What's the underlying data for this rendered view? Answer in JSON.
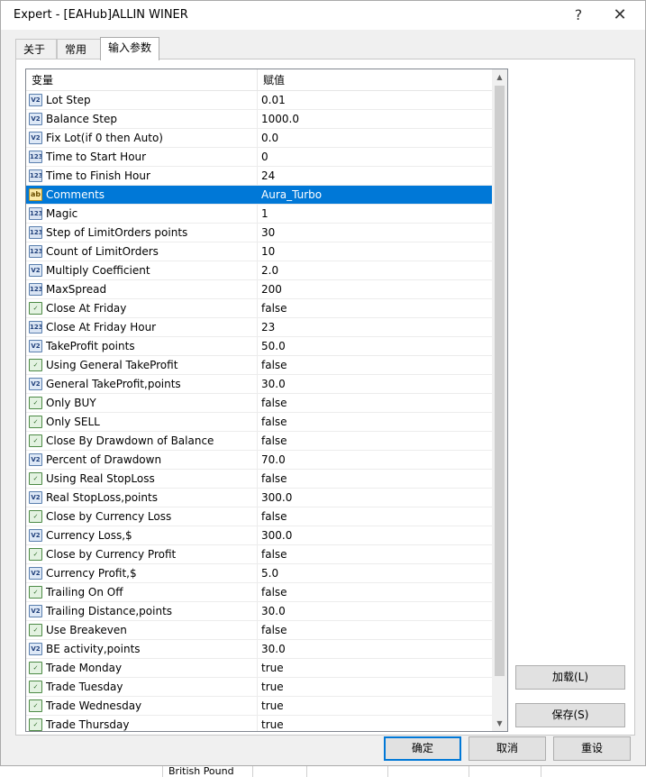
{
  "window": {
    "title": "Expert - [EAHub]ALLIN WINER",
    "help": "?",
    "close": "✕"
  },
  "tabs": [
    {
      "label": "关于"
    },
    {
      "label": "常用"
    },
    {
      "label": "输入参数"
    }
  ],
  "grid": {
    "col_variable": "变量",
    "col_value": "赋值",
    "rows": [
      {
        "type": "double",
        "icon": "V2",
        "name": "Lot Step",
        "value": "0.01"
      },
      {
        "type": "double",
        "icon": "V2",
        "name": "Balance Step",
        "value": "1000.0"
      },
      {
        "type": "double",
        "icon": "V2",
        "name": "Fix Lot(if 0 then Auto)",
        "value": "0.0"
      },
      {
        "type": "int",
        "icon": "123",
        "name": "Time to Start Hour",
        "value": "0"
      },
      {
        "type": "int",
        "icon": "123",
        "name": "Time to Finish Hour",
        "value": "24"
      },
      {
        "type": "string",
        "icon": "ab",
        "name": "Comments",
        "value": "Aura_Turbo"
      },
      {
        "type": "int",
        "icon": "123",
        "name": "Magic",
        "value": "1"
      },
      {
        "type": "int",
        "icon": "123",
        "name": "Step of LimitOrders points",
        "value": "30"
      },
      {
        "type": "int",
        "icon": "123",
        "name": "Count of LimitOrders",
        "value": "10"
      },
      {
        "type": "double",
        "icon": "V2",
        "name": "Multiply Coefficient",
        "value": "2.0"
      },
      {
        "type": "int",
        "icon": "123",
        "name": "MaxSpread",
        "value": "200"
      },
      {
        "type": "bool",
        "icon": "✓",
        "name": "Close At Friday",
        "value": "false"
      },
      {
        "type": "int",
        "icon": "123",
        "name": "Close At Friday Hour",
        "value": "23"
      },
      {
        "type": "double",
        "icon": "V2",
        "name": "TakeProfit points",
        "value": "50.0"
      },
      {
        "type": "bool",
        "icon": "✓",
        "name": "Using General TakeProfit",
        "value": "false"
      },
      {
        "type": "double",
        "icon": "V2",
        "name": "General TakeProfit,points",
        "value": "30.0"
      },
      {
        "type": "bool",
        "icon": "✓",
        "name": "Only BUY",
        "value": "false"
      },
      {
        "type": "bool",
        "icon": "✓",
        "name": "Only SELL",
        "value": "false"
      },
      {
        "type": "bool",
        "icon": "✓",
        "name": "Close By Drawdown of Balance",
        "value": "false"
      },
      {
        "type": "double",
        "icon": "V2",
        "name": "Percent of Drawdown",
        "value": "70.0"
      },
      {
        "type": "bool",
        "icon": "✓",
        "name": "Using Real StopLoss",
        "value": "false"
      },
      {
        "type": "double",
        "icon": "V2",
        "name": "Real StopLoss,points",
        "value": "300.0"
      },
      {
        "type": "bool",
        "icon": "✓",
        "name": "Close by Currency Loss",
        "value": "false"
      },
      {
        "type": "double",
        "icon": "V2",
        "name": "Currency Loss,$",
        "value": "300.0"
      },
      {
        "type": "bool",
        "icon": "✓",
        "name": "Close by Currency Profit",
        "value": "false"
      },
      {
        "type": "double",
        "icon": "V2",
        "name": "Currency Profit,$",
        "value": "5.0"
      },
      {
        "type": "bool",
        "icon": "✓",
        "name": "Trailing On Off",
        "value": "false"
      },
      {
        "type": "double",
        "icon": "V2",
        "name": "Trailing Distance,points",
        "value": "30.0"
      },
      {
        "type": "bool",
        "icon": "✓",
        "name": "Use Breakeven",
        "value": "false"
      },
      {
        "type": "double",
        "icon": "V2",
        "name": "BE activity,points",
        "value": "30.0"
      },
      {
        "type": "bool",
        "icon": "✓",
        "name": "Trade Monday",
        "value": "true"
      },
      {
        "type": "bool",
        "icon": "✓",
        "name": "Trade Tuesday",
        "value": "true"
      },
      {
        "type": "bool",
        "icon": "✓",
        "name": "Trade Wednesday",
        "value": "true"
      },
      {
        "type": "bool",
        "icon": "✓",
        "name": "Trade Thursday",
        "value": "true"
      }
    ]
  },
  "buttons": {
    "load": "加载(L)",
    "save": "保存(S)",
    "ok": "确定",
    "cancel": "取消",
    "reset": "重设"
  },
  "background": {
    "bottom_text": "British Pound"
  },
  "colors": {
    "selection": "#0078d7",
    "primary_border": "#0078d7"
  }
}
